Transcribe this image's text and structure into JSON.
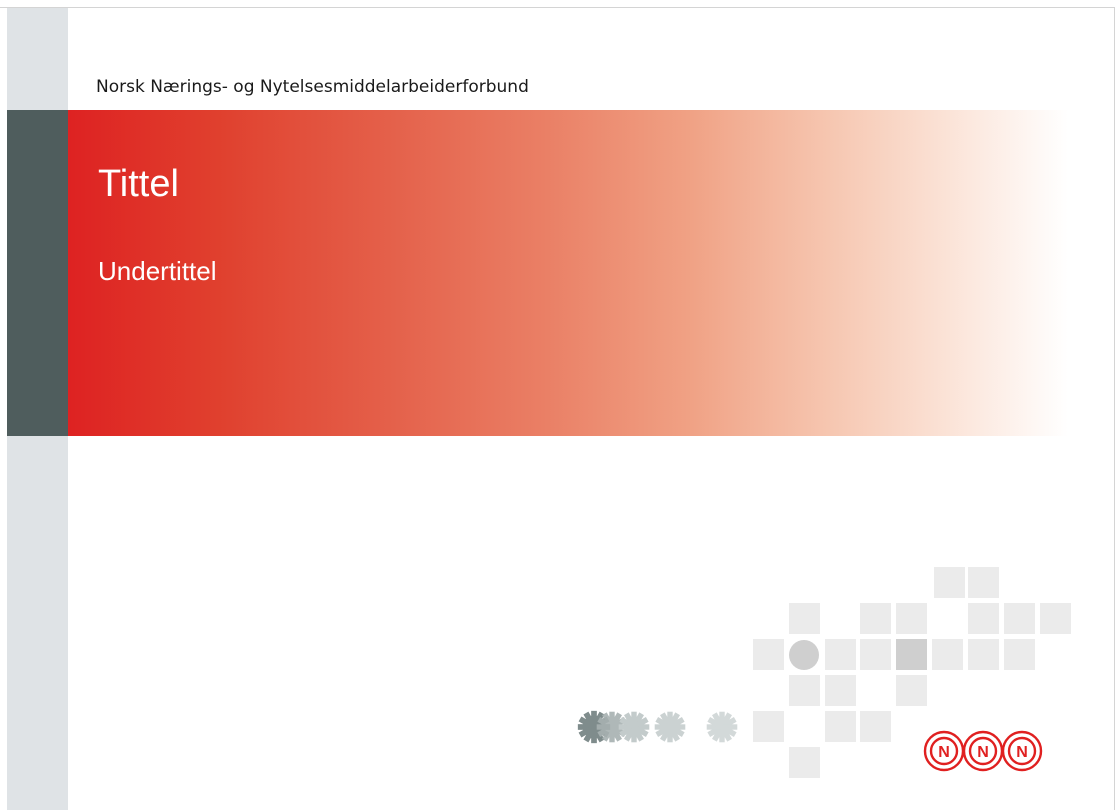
{
  "slide": {
    "organization": "Norsk Nærings- og Nytelsesmiddelarbeiderforbund",
    "title": "Tittel",
    "subtitle": "Undertittel"
  },
  "logo": {
    "letters": [
      "N",
      "N",
      "N"
    ],
    "color": "#e02020"
  },
  "colors": {
    "banner_start": "#de2222",
    "side_bar": "#dfe3e6",
    "side_bar_dark": "#4f5d5d"
  }
}
